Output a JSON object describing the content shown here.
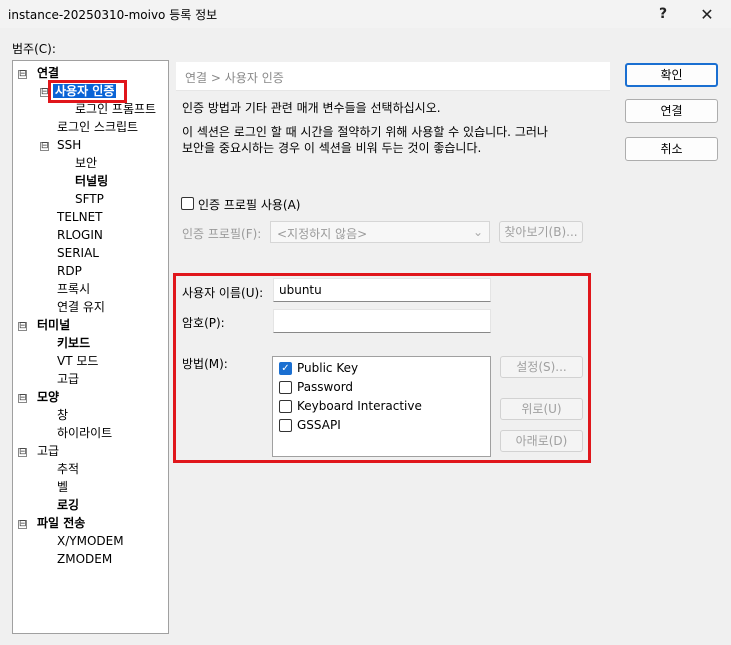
{
  "window": {
    "title": "instance-20250310-moivo 등록 정보",
    "help": "?",
    "close": "✕"
  },
  "category_label": "범주(C):",
  "tree": {
    "items": [
      {
        "label": "연결",
        "expander": "⊟"
      },
      {
        "label": "사용자 인증",
        "expander": "⊟"
      },
      {
        "label": "로그인 프롬프트"
      },
      {
        "label": "로그인 스크립트"
      },
      {
        "label": "SSH",
        "expander": "⊟"
      },
      {
        "label": "보안"
      },
      {
        "label": "터널링"
      },
      {
        "label": "SFTP"
      },
      {
        "label": "TELNET"
      },
      {
        "label": "RLOGIN"
      },
      {
        "label": "SERIAL"
      },
      {
        "label": "RDP"
      },
      {
        "label": "프록시"
      },
      {
        "label": "연결 유지"
      },
      {
        "label": "터미널",
        "expander": "⊟"
      },
      {
        "label": "키보드"
      },
      {
        "label": "VT 모드"
      },
      {
        "label": "고급"
      },
      {
        "label": "모양",
        "expander": "⊟"
      },
      {
        "label": "창"
      },
      {
        "label": "하이라이트"
      },
      {
        "label": "고급",
        "expander": "⊟"
      },
      {
        "label": "추적"
      },
      {
        "label": "벨"
      },
      {
        "label": "로깅"
      },
      {
        "label": "파일 전송",
        "expander": "⊟"
      },
      {
        "label": "X/YMODEM"
      },
      {
        "label": "ZMODEM"
      }
    ]
  },
  "breadcrumb": "연결 > 사용자 인증",
  "description": {
    "line1": "인증 방법과 기타 관련 매개 변수들을 선택하십시오.",
    "line2": "이 섹션은 로그인 할 때 시간을 절약하기 위해 사용할 수 있습니다. 그러나",
    "line3": "보안을 중요시하는 경우 이 섹션을 비워 두는 것이 좋습니다."
  },
  "profile": {
    "use_label": "인증 프로필 사용(A)",
    "use_checked": false,
    "profile_label": "인증 프로필(F):",
    "profile_value": "<지정하지 않음>",
    "browse_label": "찾아보기(B)..."
  },
  "auth": {
    "username_label": "사용자 이름(U):",
    "username_value": "ubuntu",
    "password_label": "암호(P):",
    "password_value": "",
    "method_label": "방법(M):",
    "methods": [
      {
        "label": "Public Key",
        "checked": true
      },
      {
        "label": "Password",
        "checked": false
      },
      {
        "label": "Keyboard Interactive",
        "checked": false
      },
      {
        "label": "GSSAPI",
        "checked": false
      }
    ],
    "settings_label": "설정(S)...",
    "up_label": "위로(U)",
    "down_label": "아래로(D)"
  },
  "dialog_buttons": {
    "ok": "확인",
    "connect": "연결",
    "cancel": "취소"
  },
  "colors": {
    "selection": "#0a64d6",
    "highlight_border": "#e0161b",
    "checkbox_checked": "#1a6fd1"
  }
}
